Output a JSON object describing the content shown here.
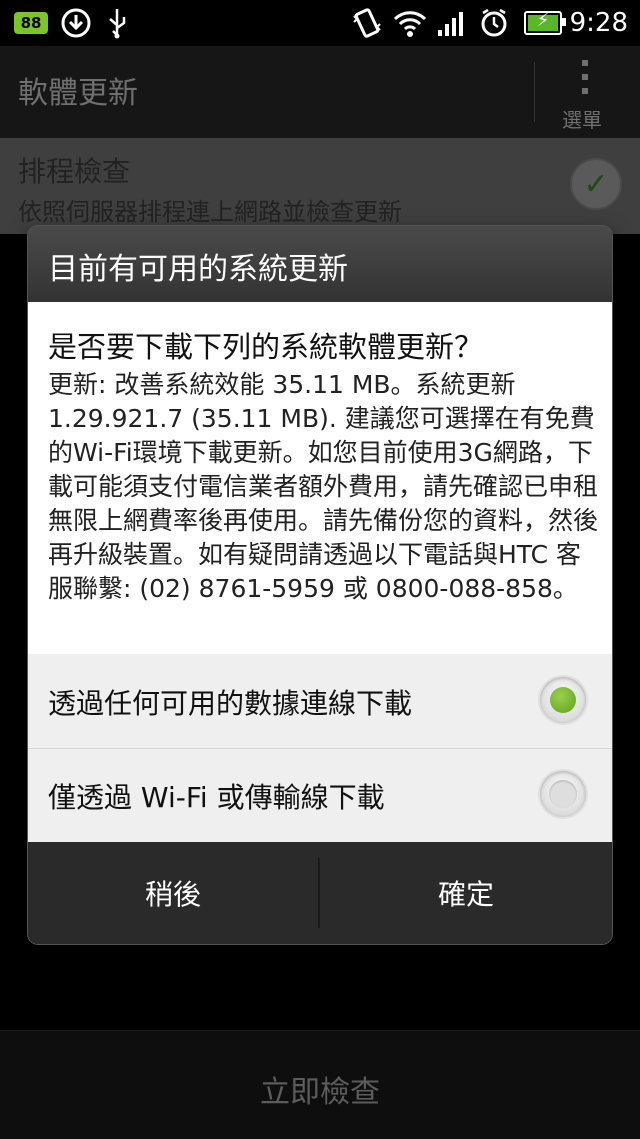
{
  "status_bar": {
    "notification_count": "88",
    "time": "9:28",
    "icons": [
      "download-icon",
      "usb-icon",
      "vibrate-icon",
      "wifi-icon",
      "signal-icon",
      "alarm-icon",
      "battery-charging-icon"
    ]
  },
  "app": {
    "title": "軟體更新",
    "menu_label": "選單"
  },
  "setting": {
    "title": "排程檢查",
    "subtitle": "依照伺服器排程連上網路並檢查更新",
    "checked": true
  },
  "dialog": {
    "title": "目前有可用的系統更新",
    "question": "是否要下載下列的系統軟體更新？",
    "details": "更新: 改善系統效能 35.11 MB。系統更新1.29.921.7 (35.11 MB). 建議您可選擇在有免費的Wi-Fi環境下載更新。如您目前使用3G網路，下載可能須支付電信業者額外費用，請先確認已申租無限上網費率後再使用。請先備份您的資料，然後再升級裝置。如有疑問請透過以下電話與HTC 客服聯繫: (02) 8761-5959 或 0800-088-858。",
    "options": [
      {
        "label": "透過任何可用的數據連線下載",
        "selected": true
      },
      {
        "label": "僅透過 Wi-Fi 或傳輸線下載",
        "selected": false
      }
    ],
    "cancel_label": "稍後",
    "ok_label": "確定"
  },
  "bottom": {
    "check_now_label": "立即檢查"
  },
  "colors": {
    "accent_green": "#7dc42b",
    "dialog_title_bg": "#3a3a3a"
  }
}
